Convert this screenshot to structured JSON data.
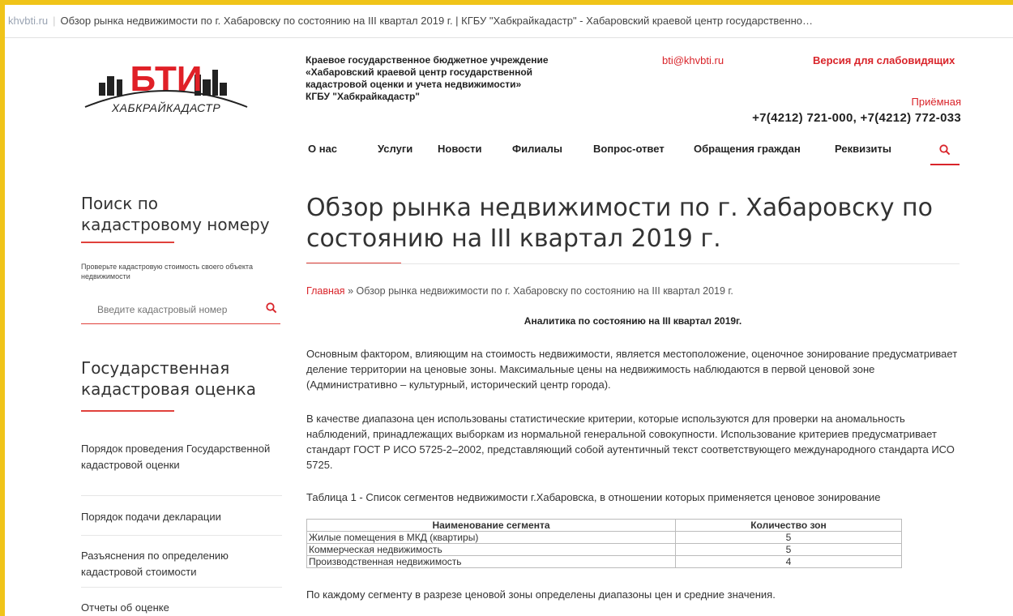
{
  "browser": {
    "site": "khvbti.ru",
    "title": "Обзор рынка недвижимости по г. Хабаровску по состоянию на III квартал 2019 г. | КГБУ \"Хабкрайкадастр\" - Хабаровский краевой центр государственно…"
  },
  "header": {
    "logo_main": "БТИ",
    "logo_sub": "ХАБКРАЙКАДАСТР",
    "org_lines": [
      "Краевое государственное бюджетное учреждение",
      "«Хабаровский краевой центр государственной",
      "кадастровой оценки и учета недвижимости»",
      "КГБУ \"Хабкрайкадастр\""
    ],
    "email": "bti@khvbti.ru",
    "vision_link": "Версия для слабовидящих",
    "reception_label": "Приёмная",
    "phones": "+7(4212) 721-000, +7(4212) 772-033"
  },
  "nav": {
    "items": [
      "О нас",
      "Услуги",
      "Новости",
      "Филиалы",
      "Вопрос-ответ",
      "Обращения граждан",
      "Реквизиты"
    ]
  },
  "sidebar": {
    "search_title": "Поиск по кадастровому номеру",
    "search_hint": "Проверьте кадастровую стоимость своего объекта недвижимости",
    "search_placeholder": "Введите кадастровый номер",
    "section_title": "Государственная кадастровая оценка",
    "links": [
      "Порядок проведения Государственной кадастровой оценки",
      "Порядок подачи декларации",
      "Разъяснения по определению кадастровой стоимости",
      "Отчеты об оценке"
    ]
  },
  "main": {
    "title": "Обзор рынка недвижимости по г. Хабаровску по состоянию на III квартал 2019 г.",
    "breadcrumb_home": "Главная",
    "breadcrumb_sep": "»",
    "breadcrumb_current": "Обзор рынка недвижимости по г. Хабаровску по состоянию на III квартал 2019 г.",
    "analytics_heading": "Аналитика по состоянию на III квартал 2019г.",
    "paragraph1": "Основным фактором, влияющим на стоимость недвижимости, является местоположение, оценочное зонирование предусматривает деление территории на ценовые зоны. Максимальные цены на недвижимость наблюдаются в первой ценовой зоне (Административно – культурный, исторический центр города).",
    "paragraph2": "В качестве диапазона цен использованы статистические критерии, которые используются для проверки на аномальность наблюдений, принадлежащих выборкам из нормальной генеральной совокупности. Использование критериев предусматривает стандарт ГОСТ Р ИСО 5725-2–2002, представляющий собой аутентичный текст соответствующего международного стандарта ИСО 5725.",
    "table_caption": "Таблица 1 - Список сегментов недвижимости г.Хабаровска, в отношении которых применяется ценовое зонирование",
    "table": {
      "headers": [
        "Наименование сегмента",
        "Количество зон"
      ],
      "rows": [
        [
          "Жилые помещения в МКД (квартиры)",
          "5"
        ],
        [
          "Коммерческая недвижимость",
          "5"
        ],
        [
          "Производственная недвижимость",
          "4"
        ]
      ]
    },
    "after_table": "По каждому сегменту в разрезе ценовой зоны определены диапазоны цен и средние значения."
  },
  "colors": {
    "accent": "#d9242a",
    "frame": "#f0c419"
  }
}
